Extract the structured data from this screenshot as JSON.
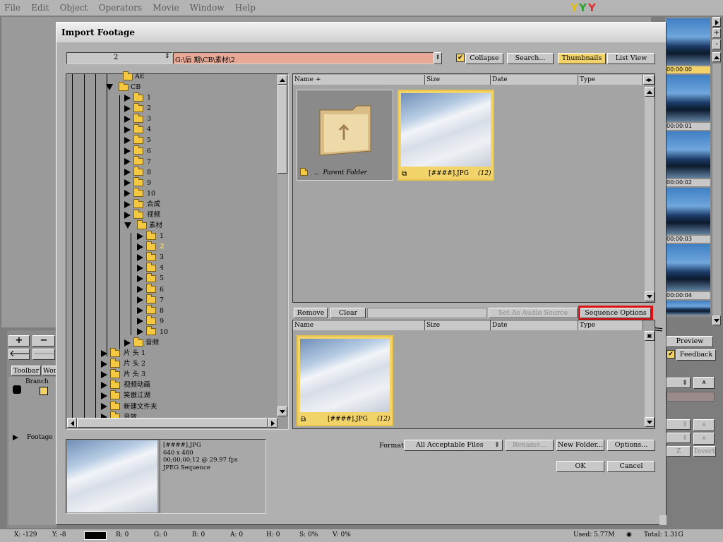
{
  "menu": [
    "File",
    "Edit",
    "Object",
    "Operators",
    "Movie",
    "Window",
    "Help"
  ],
  "dialog": {
    "title": "Import Footage",
    "path_number": "2",
    "path": "G:\\后 期\\CB\\素材\\2",
    "collapse_label": "Collapse",
    "search_label": "Search...",
    "thumbnails_label": "Thumbnails",
    "listview_label": "List View",
    "columns": {
      "name": "Name +",
      "size": "Size",
      "date": "Date",
      "type": "Type"
    },
    "columns_lower": {
      "name": "Name",
      "size": "Size",
      "date": "Date",
      "type": "Type"
    },
    "files": [
      {
        "label": "Parent Folder",
        "prefix": ".."
      },
      {
        "label": "[####].JPG",
        "count": "(12)"
      }
    ],
    "selected_files": [
      {
        "label": "[####].JPG",
        "count": "(12)"
      }
    ],
    "remove_label": "Remove",
    "clear_label": "Clear",
    "audio_source_label": "Set As Audio Source",
    "sequence_options_label": "Sequence Options",
    "preview_info": [
      "[####].JPG",
      "640 x 480",
      "00;00;00;12 @ 29.97 fps",
      "JPEG Sequence"
    ],
    "format_label": "Format",
    "format_value": "All Acceptable Files",
    "rename_label": "Rename...",
    "new_folder_label": "New Folder...",
    "options_label": "Options...",
    "ok_label": "OK",
    "cancel_label": "Cancel"
  },
  "tree": {
    "top_partial": "AE",
    "cb": "CB",
    "cb_children": [
      "1",
      "2",
      "3",
      "4",
      "5",
      "6",
      "7",
      "8",
      "9",
      "10",
      "合成",
      "视频"
    ],
    "sucai": "素材",
    "sucai_children": [
      "1",
      "2",
      "3",
      "4",
      "5",
      "6",
      "7",
      "8",
      "9",
      "10"
    ],
    "yinpin": "音频",
    "root_items": [
      "片 头 1",
      "片 头 2",
      "片 头 3",
      "视频动画",
      "笑傲江湖",
      "新建文件夹",
      "音效"
    ]
  },
  "right_strip": {
    "timecodes": [
      "00:00:00",
      "00:00:01",
      "00:00:02",
      "00:00:03",
      "00:00:04"
    ]
  },
  "right_panel": {
    "preview_label": "Preview",
    "feedback_label": "Feedback",
    "z_label": "Z",
    "invert_label": "Invert"
  },
  "left_panel": {
    "plus": "+",
    "minus": "−",
    "tabs": [
      "Toolbar",
      "Wor"
    ],
    "branch_label": "Branch",
    "footage_label": "Footage"
  },
  "statusbar": {
    "x": "X: -129",
    "y": "Y: -8",
    "r": "R: 0",
    "g": "G: 0",
    "b": "B: 0",
    "a": "A: 0",
    "h": "H: 0",
    "s": "S: 0%",
    "v": "V: 0%",
    "used": "Used: 5.77M",
    "total": "Total: 1.31G"
  },
  "colors": {
    "accent_yellow": "#f2d36a",
    "path_bg": "#e8a896",
    "highlight_red": "#e01010"
  }
}
